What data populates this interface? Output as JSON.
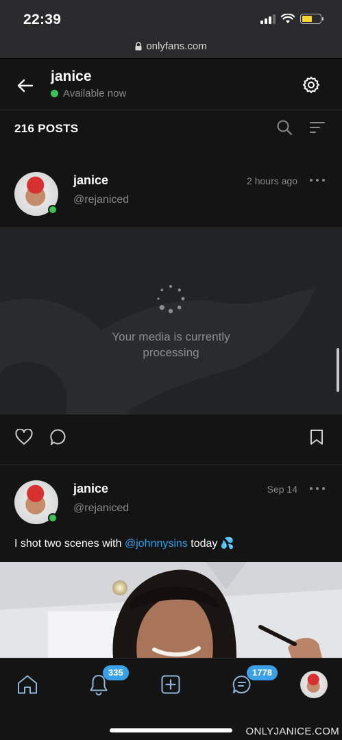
{
  "status_bar": {
    "time": "22:39"
  },
  "browser": {
    "url": "onlyfans.com"
  },
  "profile": {
    "name": "janice",
    "status": "Available now"
  },
  "posts_bar": {
    "count_label": "216 POSTS"
  },
  "posts": [
    {
      "name": "janice",
      "handle": "@rejaniced",
      "time": "2 hours ago",
      "media_status": "Your media is currently processing"
    },
    {
      "name": "janice",
      "handle": "@rejaniced",
      "time": "Sep 14",
      "caption_before": "I shot two scenes with ",
      "caption_mention": "@johnnysins",
      "caption_after": " today 💦"
    }
  ],
  "tabbar": {
    "notifications_badge": "335",
    "messages_badge": "1778"
  },
  "watermark": "ONLYJANICE.COM",
  "colors": {
    "accent": "#3aa0e8",
    "online": "#3cc157",
    "battery": "#f5d731"
  },
  "icons": [
    "signal-icon",
    "wifi-icon",
    "battery-icon",
    "lock-icon",
    "back-arrow-icon",
    "gear-icon",
    "search-icon",
    "sort-icon",
    "more-icon",
    "heart-icon",
    "comment-icon",
    "bookmark-icon",
    "home-icon",
    "bell-icon",
    "add-icon",
    "messages-icon"
  ]
}
